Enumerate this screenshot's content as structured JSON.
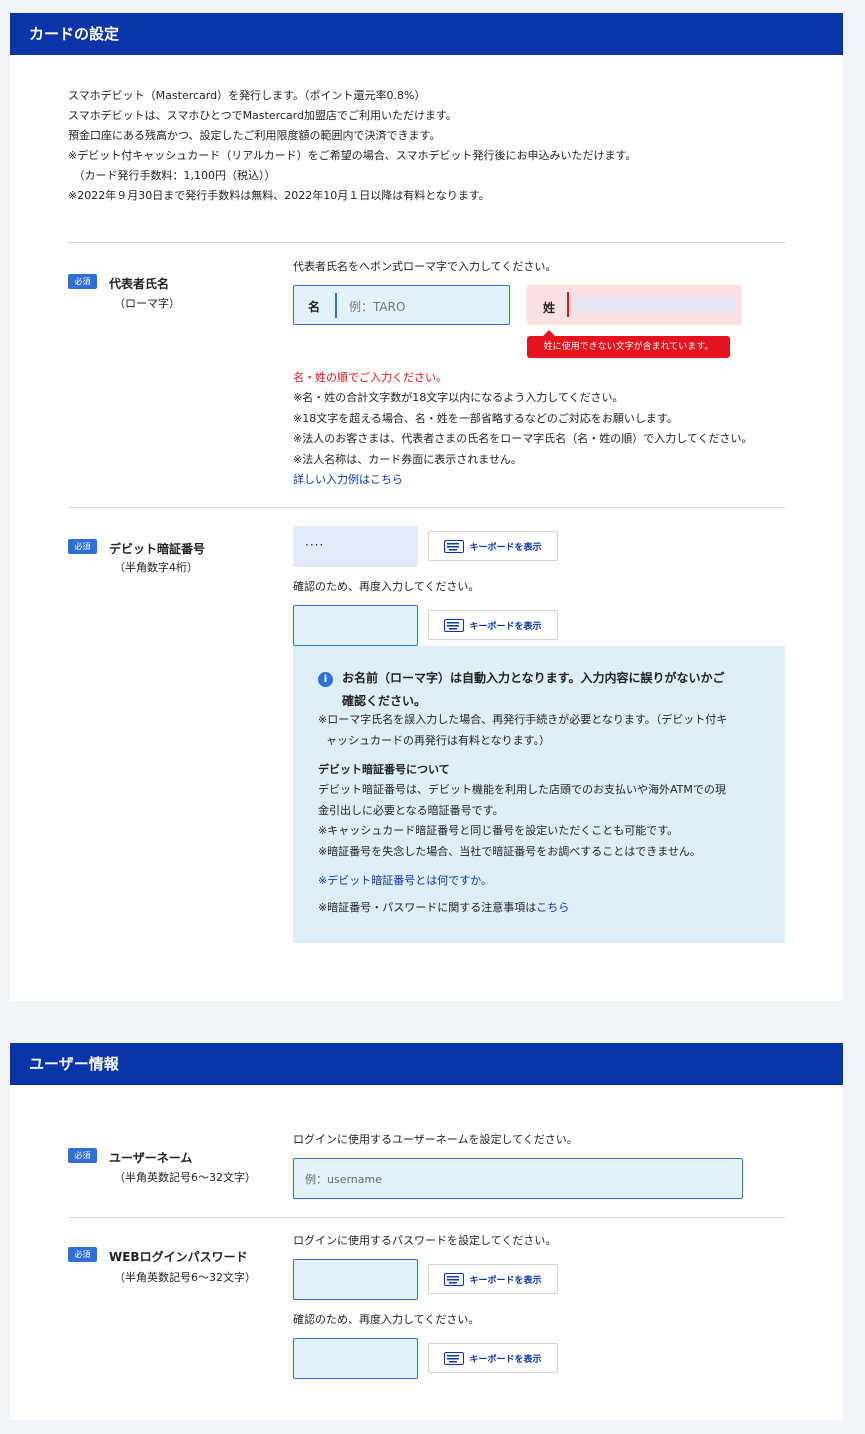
{
  "card_settings": {
    "title": "カードの設定",
    "intro": [
      "スマホデビット（Mastercard）を発行します。（ポイント還元率0.8%）",
      "スマホデビットは、スマホひとつでMastercard加盟店でご利用いただけます。",
      "預金口座にある残高かつ、設定したご利用限度額の範囲内で決済できます。",
      "※デビット付キャッシュカード（リアルカード）をご希望の場合、スマホデビット発行後にお申込みいただけます。",
      "　（カード発行手数料：1,100円（税込））",
      "※2022年９月30日まで発行手数料は無料、2022年10月１日以降は有料となります。"
    ],
    "name_field": {
      "badge": "必須",
      "label": "代表者氏名",
      "sublabel": "（ローマ字）",
      "instruction": "代表者氏名をヘボン式ローマ字で入力してください。",
      "first_label": "名",
      "first_placeholder": "例：TARO",
      "last_label": "姓",
      "error_tooltip": "姓に使用できない文字が含まれています。",
      "order_warning": "名・姓の順でご入力ください。",
      "notes": [
        "※名・姓の合計文字数が18文字以内になるよう入力してください。",
        "※18文字を超える場合、名・姓を一部省略するなどのご対応をお願いします。",
        "※法人のお客さまは、代表者さまの氏名をローマ字氏名（名・姓の順）で入力してください。",
        "※法人名称は、カード券面に表示されません。"
      ],
      "detail_link": "詳しい入力例はこちら"
    },
    "pin_field": {
      "badge": "必須",
      "label": "デビット暗証番号",
      "sublabel": "（半角数字4桁）",
      "pin_value": "····",
      "keyboard_label": "キーボードを表示",
      "confirm_text": "確認のため、再度入力してください。"
    },
    "info_box": {
      "icon": "i",
      "notice_line1": "お名前（ローマ字）は自動入力となります。入力内容に誤りがないかご",
      "notice_line2": "確認ください。",
      "note_line1": "※ローマ字氏名を誤入力した場合、再発行手続きが必要となります。（デビット付キ",
      "note_line2": "ャッシュカードの再発行は有料となります。）",
      "pin_heading": "デビット暗証番号について",
      "pin_desc_line1": "デビット暗証番号は、デビット機能を利用した店頭でのお支払いや海外ATMでの現",
      "pin_desc_line2": "金引出しに必要となる暗証番号です。",
      "pin_note1": "※キャッシュカード暗証番号と同じ番号を設定いただくことも可能です。",
      "pin_note2": "※暗証番号を失念した場合、当社で暗証番号をお調べすることはできません。",
      "what_link": "※デビット暗証番号とは何ですか。",
      "caution_prefix": "※暗証番号・パスワードに関する注意事項は",
      "caution_link": "こちら"
    }
  },
  "user_info": {
    "title": "ユーザー情報",
    "username": {
      "badge": "必須",
      "label": "ユーザーネーム",
      "sublabel": "（半角英数記号6〜32文字）",
      "instruction": "ログインに使用するユーザーネームを設定してください。",
      "placeholder": "例：username"
    },
    "password": {
      "badge": "必須",
      "label": "WEBログインパスワード",
      "sublabel": "（半角英数記号6〜32文字）",
      "instruction": "ログインに使用するパスワードを設定してください。",
      "keyboard_label": "キーボードを表示",
      "confirm_text": "確認のため、再度入力してください。"
    }
  }
}
